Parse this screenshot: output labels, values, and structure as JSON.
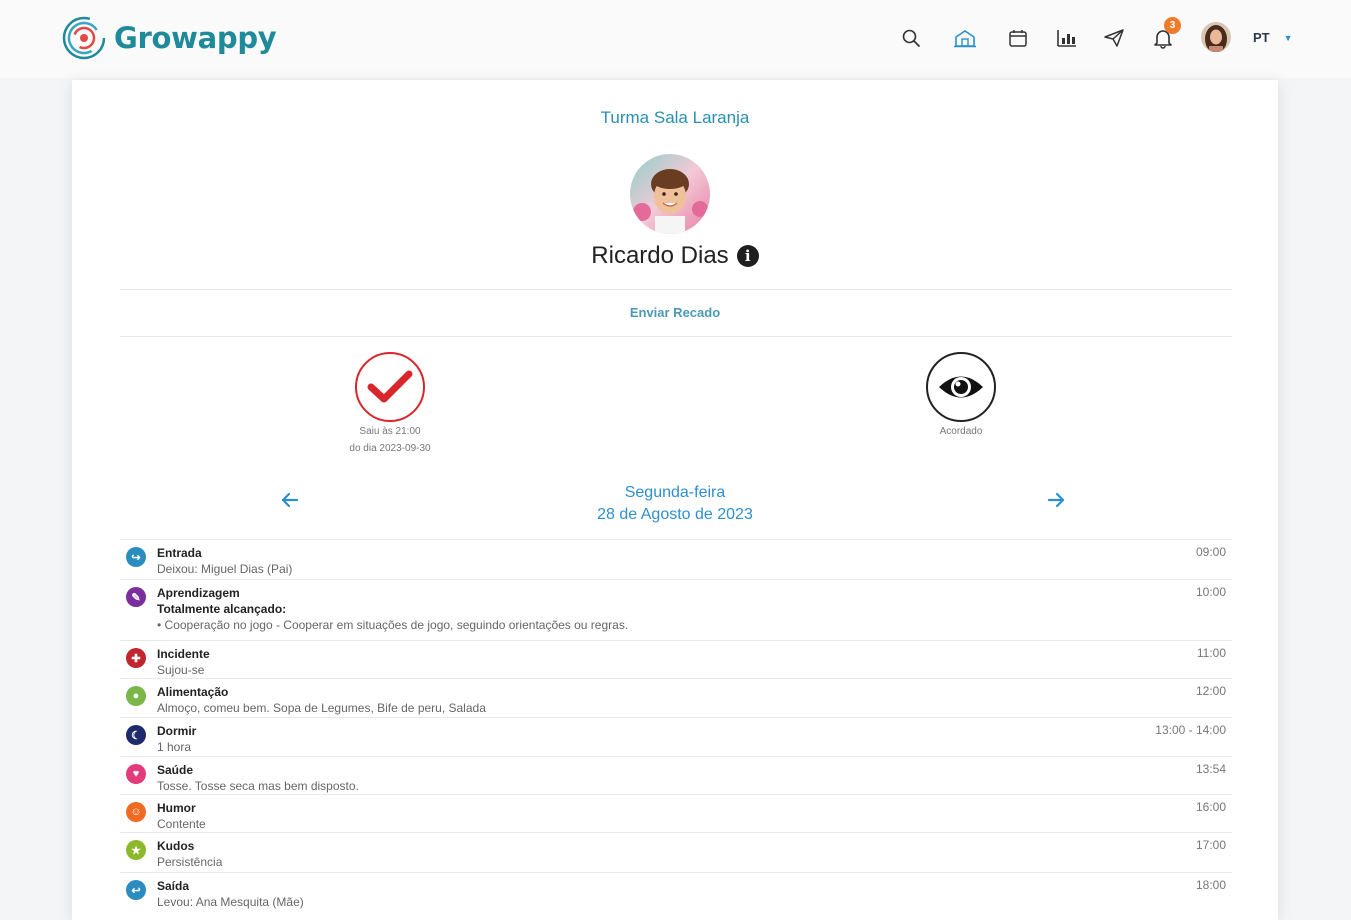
{
  "app": {
    "brand": "Growappy",
    "colors": {
      "brand": "#1f8a9a",
      "link": "#2f8fcf",
      "badge": "#f07b2b",
      "check": "#d9262c"
    }
  },
  "nav": {
    "icons": [
      "search-icon",
      "school-icon",
      "calendar-icon",
      "chart-icon",
      "send-icon",
      "bell-icon"
    ],
    "notification_count": "3",
    "language": "PT"
  },
  "profile": {
    "class_name": "Turma Sala Laranja",
    "child_name": "Ricardo Dias",
    "send_message": "Enviar Recado"
  },
  "statuses": [
    {
      "icon": "check-icon",
      "line1": "Saiu às 21:00",
      "line2": "do dia 2023-09-30"
    },
    {
      "icon": "eye-icon",
      "line1": "Acordado",
      "line2": ""
    }
  ],
  "date": {
    "weekday": "Segunda-feira",
    "full": "28 de Agosto de 2023"
  },
  "activities": [
    {
      "icon": "entry-icon",
      "color": "#2b8cbf",
      "title": "Entrada",
      "desc": "Deixou: Miguel Dias (Pai)",
      "time": "09:00"
    },
    {
      "icon": "learning-icon",
      "color": "#7b2f9e",
      "title": "Aprendizagem",
      "desc_strong": "Totalmente alcançado:",
      "desc": "• Cooperação no jogo - Cooperar em situações de jogo, seguindo orientações ou regras.",
      "time": "10:00"
    },
    {
      "icon": "incident-icon",
      "color": "#c0262d",
      "title": "Incidente",
      "desc": "Sujou-se",
      "time": "11:00"
    },
    {
      "icon": "food-icon",
      "color": "#7ab648",
      "title": "Alimentação",
      "desc": "Almoço, comeu bem. Sopa de Legumes, Bife de peru, Salada",
      "time": "12:00"
    },
    {
      "icon": "sleep-icon",
      "color": "#1d2a6b",
      "title": "Dormir",
      "desc": "1 hora",
      "time": "13:00 - 14:00"
    },
    {
      "icon": "health-icon",
      "color": "#e23a7a",
      "title": "Saúde",
      "desc": "Tosse. Tosse seca mas bem disposto.",
      "time": "13:54"
    },
    {
      "icon": "mood-icon",
      "color": "#ef6a22",
      "title": "Humor",
      "desc": "Contente",
      "time": "16:00"
    },
    {
      "icon": "kudos-icon",
      "color": "#8cb92c",
      "title": "Kudos",
      "desc": "Persistência",
      "time": "17:00"
    },
    {
      "icon": "exit-icon",
      "color": "#2b8cbf",
      "title": "Saída",
      "desc": "Levou: Ana Mesquita (Mãe)",
      "time": "18:00"
    }
  ]
}
